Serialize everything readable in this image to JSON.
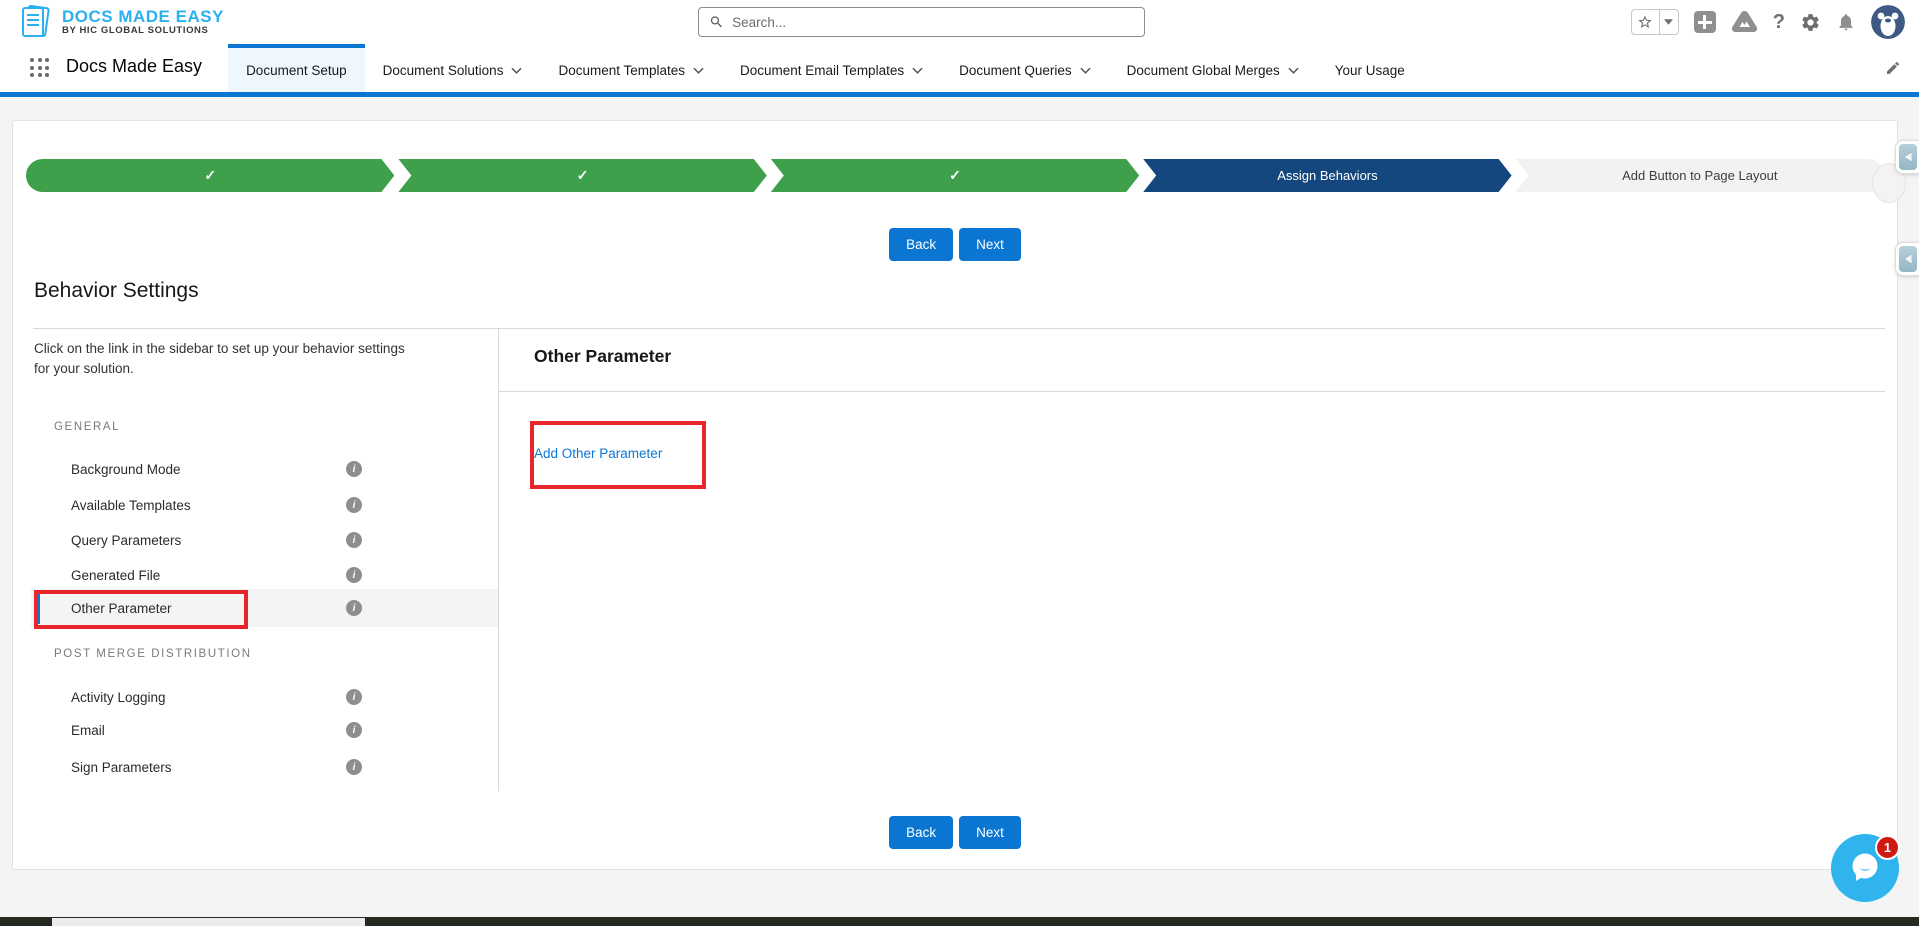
{
  "header": {
    "logo_title": "DOCS MADE EASY",
    "logo_subtitle": "BY HIC GLOBAL SOLUTIONS",
    "search_placeholder": "Search...",
    "app_name": "Docs Made Easy",
    "question_glyph": "?"
  },
  "nav_tabs": [
    {
      "label": "Document Setup",
      "active": true,
      "dropdown": false
    },
    {
      "label": "Document Solutions",
      "active": false,
      "dropdown": true
    },
    {
      "label": "Document Templates",
      "active": false,
      "dropdown": true
    },
    {
      "label": "Document Email Templates",
      "active": false,
      "dropdown": true
    },
    {
      "label": "Document Queries",
      "active": false,
      "dropdown": true
    },
    {
      "label": "Document Global Merges",
      "active": false,
      "dropdown": true
    },
    {
      "label": "Your Usage",
      "active": false,
      "dropdown": false
    }
  ],
  "stepper": {
    "completed_steps": 3,
    "check_glyph": "✓",
    "current_step": "Assign Behaviors",
    "next_step": "Add Button to Page Layout",
    "colors": {
      "complete": "#3fa04c",
      "current": "#15477f",
      "upcoming": "#f2f2f2"
    }
  },
  "actions": {
    "back": "Back",
    "next": "Next"
  },
  "page_title": "Behavior Settings",
  "sidebar": {
    "description": "Click on the link in the sidebar to set up your behavior settings for your solution.",
    "info_glyph": "i",
    "sections": [
      {
        "title": "GENERAL",
        "items": [
          {
            "label": "Background Mode"
          },
          {
            "label": "Available Templates"
          },
          {
            "label": "Query Parameters"
          },
          {
            "label": "Generated File"
          },
          {
            "label": "Other Parameter",
            "selected": true
          }
        ]
      },
      {
        "title": "POST MERGE DISTRIBUTION",
        "items": [
          {
            "label": "Activity Logging"
          },
          {
            "label": "Email"
          },
          {
            "label": "Sign Parameters"
          }
        ]
      }
    ]
  },
  "panel": {
    "title": "Other Parameter",
    "add_link": "Add Other Parameter"
  },
  "chat": {
    "badge": "1"
  },
  "annotation_color": "#e8252a",
  "accent_colors": {
    "brand_blue": "#0b76d2",
    "logo_blue": "#2bb0ef",
    "chat_blue": "#30b4ee"
  }
}
